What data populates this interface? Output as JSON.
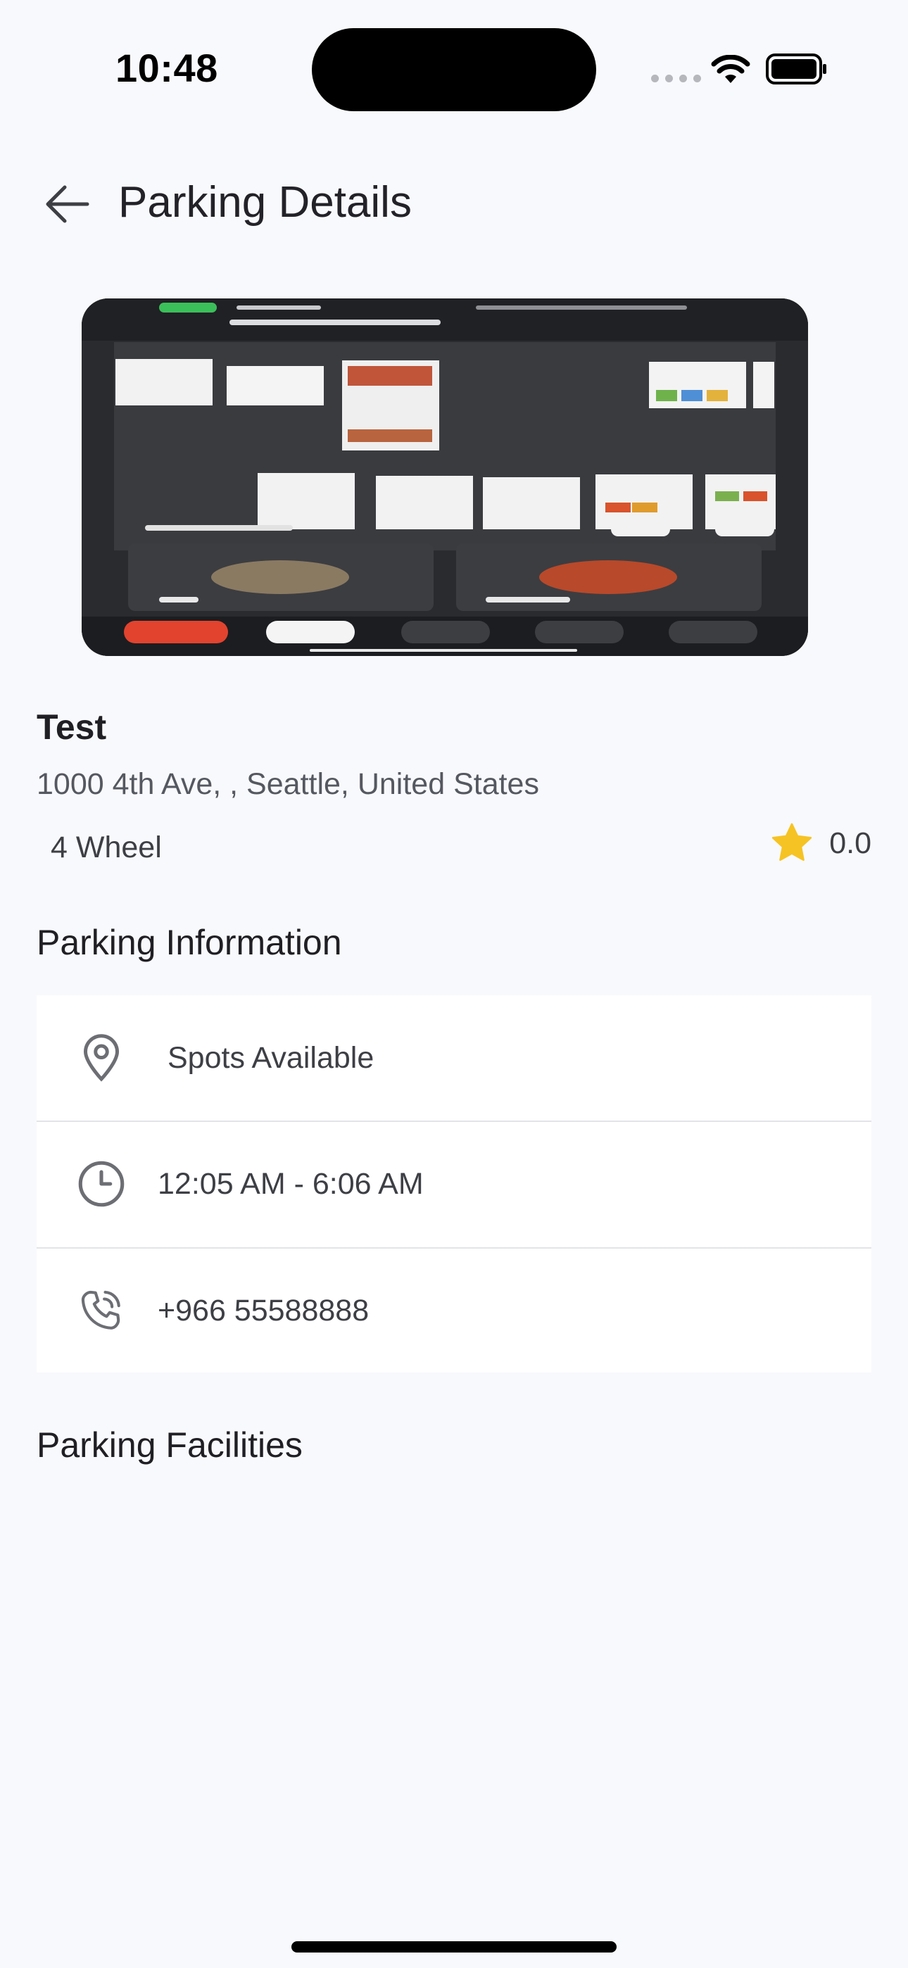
{
  "status_bar": {
    "time": "10:48"
  },
  "header": {
    "title": "Parking Details",
    "back_icon": "arrow-left-icon"
  },
  "parking": {
    "name": "Test",
    "address": "1000 4th Ave, , Seattle, United States",
    "vehicle_type": "4 Wheel",
    "rating": "0.0",
    "rating_icon": "star-icon"
  },
  "info_section": {
    "title": "Parking Information",
    "rows": [
      {
        "icon": "location-pin-icon",
        "text": "Spots Available"
      },
      {
        "icon": "clock-icon",
        "text": "12:05 AM - 6:06 AM"
      },
      {
        "icon": "phone-icon",
        "text": "+966 55588888"
      }
    ]
  },
  "facilities_section": {
    "title": "Parking Facilities"
  },
  "colors": {
    "background": "#f8f9fc",
    "card": "#ffffff",
    "star": "#f6c324",
    "icon_gray": "#6c6e74"
  }
}
